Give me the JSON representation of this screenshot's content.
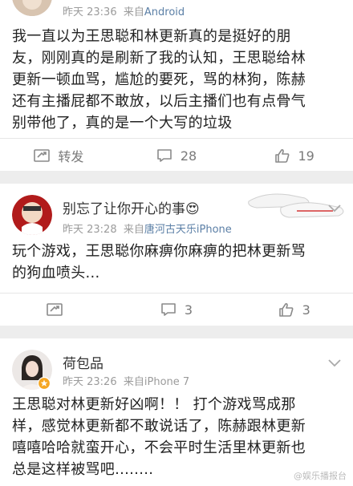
{
  "comments": [
    {
      "name": "",
      "time": "昨天 23:36",
      "source_prefix": "来自",
      "source_app": "Android",
      "lines": [
        "我一直以为王思聪和林更新真的是挺好的朋",
        "友，刚刚真的是刷新了我的认知，王思聪给林",
        "更新一顿血骂，尴尬的要死，骂的林狗，陈赫",
        "还有主播屁都不敢放，以后主播们也有点骨气",
        "别带他了，真的是一个大写的垃圾"
      ],
      "repost_label": "转发",
      "comment_count": "28",
      "like_count": "19"
    },
    {
      "name": "别忘了让你开心的事",
      "emoji": "😍",
      "time": "昨天 23:28",
      "source_prefix": "来自",
      "source_app": "唐河古天乐iPhone",
      "lines": [
        "玩个游戏，王思聪你麻痹你麻痹的把林更新骂",
        "的狗血喷头..."
      ],
      "repost_label": "",
      "comment_count": "3",
      "like_count": "3"
    },
    {
      "name": "荷包品",
      "time": "昨天 23:26",
      "source_prefix": "来自",
      "source_app": "iPhone 7",
      "lines": [
        "王思聪对林更新好凶啊！！ 打个游戏骂成那",
        "样，感觉林更新都不敢说话了，陈赫跟林更新",
        "嘻嘻哈哈就蛮开心，不会平时生活里林更新也",
        "总是这样被骂吧........"
      ]
    }
  ],
  "watermark": "@娱乐播报台",
  "colors": {
    "bg": "#ededed",
    "source_link": "#5b7fa6",
    "meta": "#9b9b9b"
  }
}
